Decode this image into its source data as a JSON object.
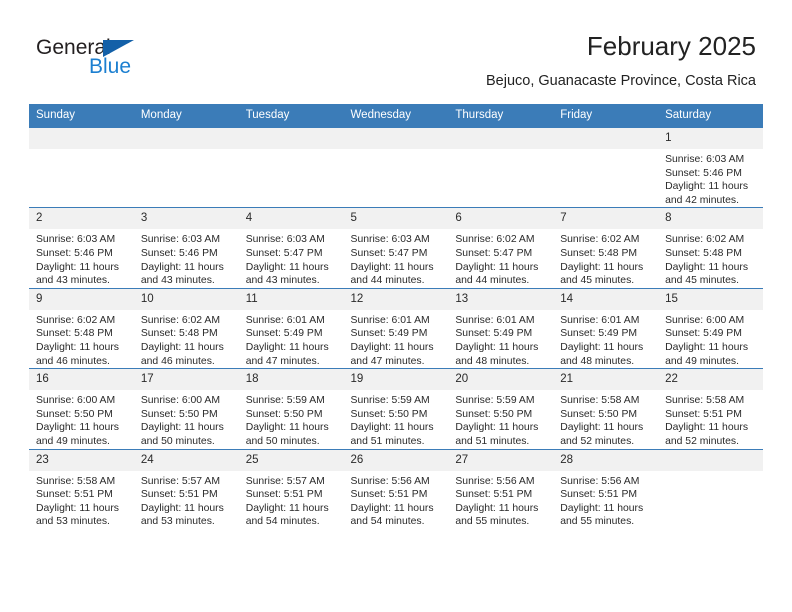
{
  "brand": {
    "name_part1": "General",
    "name_part2": "Blue",
    "accent_color": "#1c7fd0",
    "triangle_color": "#1360a8",
    "logo_icon": "triangle-flag-icon"
  },
  "header": {
    "month_title": "February 2025",
    "location": "Bejuco, Guanacaste Province, Costa Rica"
  },
  "calendar": {
    "header_color": "#3b7cb8",
    "daynum_band_color": "#f1f1f1",
    "weekday_headers": [
      "Sunday",
      "Monday",
      "Tuesday",
      "Wednesday",
      "Thursday",
      "Friday",
      "Saturday"
    ],
    "weeks": [
      [
        {
          "day": "",
          "sunrise": "",
          "sunset": "",
          "daylight1": "",
          "daylight2": ""
        },
        {
          "day": "",
          "sunrise": "",
          "sunset": "",
          "daylight1": "",
          "daylight2": ""
        },
        {
          "day": "",
          "sunrise": "",
          "sunset": "",
          "daylight1": "",
          "daylight2": ""
        },
        {
          "day": "",
          "sunrise": "",
          "sunset": "",
          "daylight1": "",
          "daylight2": ""
        },
        {
          "day": "",
          "sunrise": "",
          "sunset": "",
          "daylight1": "",
          "daylight2": ""
        },
        {
          "day": "",
          "sunrise": "",
          "sunset": "",
          "daylight1": "",
          "daylight2": ""
        },
        {
          "day": "1",
          "sunrise": "Sunrise: 6:03 AM",
          "sunset": "Sunset: 5:46 PM",
          "daylight1": "Daylight: 11 hours",
          "daylight2": "and 42 minutes."
        }
      ],
      [
        {
          "day": "2",
          "sunrise": "Sunrise: 6:03 AM",
          "sunset": "Sunset: 5:46 PM",
          "daylight1": "Daylight: 11 hours",
          "daylight2": "and 43 minutes."
        },
        {
          "day": "3",
          "sunrise": "Sunrise: 6:03 AM",
          "sunset": "Sunset: 5:46 PM",
          "daylight1": "Daylight: 11 hours",
          "daylight2": "and 43 minutes."
        },
        {
          "day": "4",
          "sunrise": "Sunrise: 6:03 AM",
          "sunset": "Sunset: 5:47 PM",
          "daylight1": "Daylight: 11 hours",
          "daylight2": "and 43 minutes."
        },
        {
          "day": "5",
          "sunrise": "Sunrise: 6:03 AM",
          "sunset": "Sunset: 5:47 PM",
          "daylight1": "Daylight: 11 hours",
          "daylight2": "and 44 minutes."
        },
        {
          "day": "6",
          "sunrise": "Sunrise: 6:02 AM",
          "sunset": "Sunset: 5:47 PM",
          "daylight1": "Daylight: 11 hours",
          "daylight2": "and 44 minutes."
        },
        {
          "day": "7",
          "sunrise": "Sunrise: 6:02 AM",
          "sunset": "Sunset: 5:48 PM",
          "daylight1": "Daylight: 11 hours",
          "daylight2": "and 45 minutes."
        },
        {
          "day": "8",
          "sunrise": "Sunrise: 6:02 AM",
          "sunset": "Sunset: 5:48 PM",
          "daylight1": "Daylight: 11 hours",
          "daylight2": "and 45 minutes."
        }
      ],
      [
        {
          "day": "9",
          "sunrise": "Sunrise: 6:02 AM",
          "sunset": "Sunset: 5:48 PM",
          "daylight1": "Daylight: 11 hours",
          "daylight2": "and 46 minutes."
        },
        {
          "day": "10",
          "sunrise": "Sunrise: 6:02 AM",
          "sunset": "Sunset: 5:48 PM",
          "daylight1": "Daylight: 11 hours",
          "daylight2": "and 46 minutes."
        },
        {
          "day": "11",
          "sunrise": "Sunrise: 6:01 AM",
          "sunset": "Sunset: 5:49 PM",
          "daylight1": "Daylight: 11 hours",
          "daylight2": "and 47 minutes."
        },
        {
          "day": "12",
          "sunrise": "Sunrise: 6:01 AM",
          "sunset": "Sunset: 5:49 PM",
          "daylight1": "Daylight: 11 hours",
          "daylight2": "and 47 minutes."
        },
        {
          "day": "13",
          "sunrise": "Sunrise: 6:01 AM",
          "sunset": "Sunset: 5:49 PM",
          "daylight1": "Daylight: 11 hours",
          "daylight2": "and 48 minutes."
        },
        {
          "day": "14",
          "sunrise": "Sunrise: 6:01 AM",
          "sunset": "Sunset: 5:49 PM",
          "daylight1": "Daylight: 11 hours",
          "daylight2": "and 48 minutes."
        },
        {
          "day": "15",
          "sunrise": "Sunrise: 6:00 AM",
          "sunset": "Sunset: 5:49 PM",
          "daylight1": "Daylight: 11 hours",
          "daylight2": "and 49 minutes."
        }
      ],
      [
        {
          "day": "16",
          "sunrise": "Sunrise: 6:00 AM",
          "sunset": "Sunset: 5:50 PM",
          "daylight1": "Daylight: 11 hours",
          "daylight2": "and 49 minutes."
        },
        {
          "day": "17",
          "sunrise": "Sunrise: 6:00 AM",
          "sunset": "Sunset: 5:50 PM",
          "daylight1": "Daylight: 11 hours",
          "daylight2": "and 50 minutes."
        },
        {
          "day": "18",
          "sunrise": "Sunrise: 5:59 AM",
          "sunset": "Sunset: 5:50 PM",
          "daylight1": "Daylight: 11 hours",
          "daylight2": "and 50 minutes."
        },
        {
          "day": "19",
          "sunrise": "Sunrise: 5:59 AM",
          "sunset": "Sunset: 5:50 PM",
          "daylight1": "Daylight: 11 hours",
          "daylight2": "and 51 minutes."
        },
        {
          "day": "20",
          "sunrise": "Sunrise: 5:59 AM",
          "sunset": "Sunset: 5:50 PM",
          "daylight1": "Daylight: 11 hours",
          "daylight2": "and 51 minutes."
        },
        {
          "day": "21",
          "sunrise": "Sunrise: 5:58 AM",
          "sunset": "Sunset: 5:50 PM",
          "daylight1": "Daylight: 11 hours",
          "daylight2": "and 52 minutes."
        },
        {
          "day": "22",
          "sunrise": "Sunrise: 5:58 AM",
          "sunset": "Sunset: 5:51 PM",
          "daylight1": "Daylight: 11 hours",
          "daylight2": "and 52 minutes."
        }
      ],
      [
        {
          "day": "23",
          "sunrise": "Sunrise: 5:58 AM",
          "sunset": "Sunset: 5:51 PM",
          "daylight1": "Daylight: 11 hours",
          "daylight2": "and 53 minutes."
        },
        {
          "day": "24",
          "sunrise": "Sunrise: 5:57 AM",
          "sunset": "Sunset: 5:51 PM",
          "daylight1": "Daylight: 11 hours",
          "daylight2": "and 53 minutes."
        },
        {
          "day": "25",
          "sunrise": "Sunrise: 5:57 AM",
          "sunset": "Sunset: 5:51 PM",
          "daylight1": "Daylight: 11 hours",
          "daylight2": "and 54 minutes."
        },
        {
          "day": "26",
          "sunrise": "Sunrise: 5:56 AM",
          "sunset": "Sunset: 5:51 PM",
          "daylight1": "Daylight: 11 hours",
          "daylight2": "and 54 minutes."
        },
        {
          "day": "27",
          "sunrise": "Sunrise: 5:56 AM",
          "sunset": "Sunset: 5:51 PM",
          "daylight1": "Daylight: 11 hours",
          "daylight2": "and 55 minutes."
        },
        {
          "day": "28",
          "sunrise": "Sunrise: 5:56 AM",
          "sunset": "Sunset: 5:51 PM",
          "daylight1": "Daylight: 11 hours",
          "daylight2": "and 55 minutes."
        },
        {
          "day": "",
          "sunrise": "",
          "sunset": "",
          "daylight1": "",
          "daylight2": ""
        }
      ]
    ]
  }
}
